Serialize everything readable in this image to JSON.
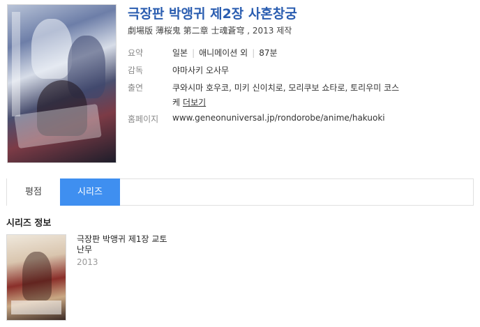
{
  "movie": {
    "title": "극장판 박앵귀 제2장 사혼창궁",
    "original_title": "劇場版 薄桜鬼 第二章 士魂蒼穹 , 2013 제작"
  },
  "info": {
    "summary_label": "요약",
    "country": "일본",
    "genre": "애니메이션 외",
    "runtime": "87분",
    "director_label": "감독",
    "director": "야마사키 오사무",
    "cast_label": "출연",
    "cast_line1": "쿠와시마 호우코, 미키 신이치로, 모리쿠보 쇼타로, 토리우미 코스",
    "cast_line2": "케",
    "more_label": "더보기",
    "homepage_label": "홈페이지",
    "homepage": "www.geneonuniversal.jp/rondorobe/anime/hakuoki"
  },
  "tabs": [
    {
      "label": "평점",
      "active": false
    },
    {
      "label": "시리즈",
      "active": true
    }
  ],
  "series": {
    "section_title": "시리즈 정보",
    "items": [
      {
        "name": "극장판 박앵귀 제1장 교토난무",
        "year": "2013"
      }
    ]
  },
  "colors": {
    "title": "#2a5db0",
    "active_tab": "#3f8ff0",
    "homepage_link": "#4d7a2f"
  },
  "icons": {
    "poster": "movie-poster-image",
    "series_poster": "series-poster-image"
  }
}
